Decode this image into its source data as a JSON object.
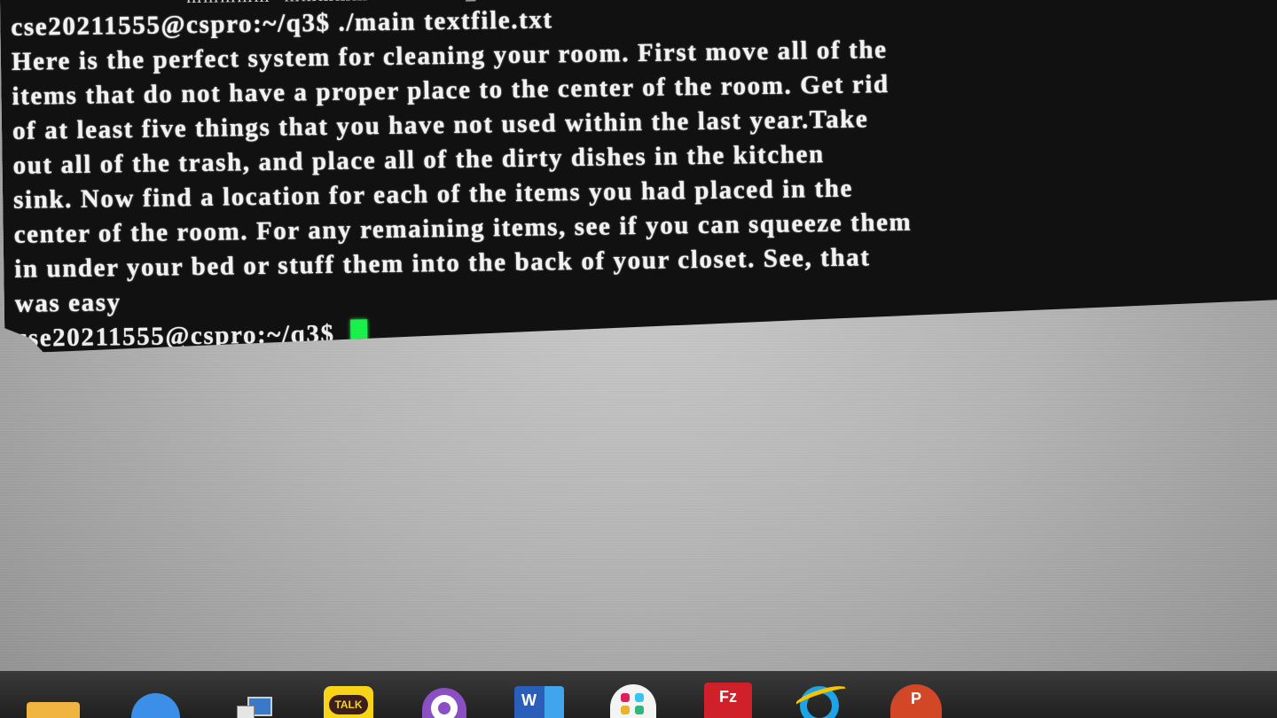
{
  "terminal": {
    "top_fragment": "mmmmm  mmmmm            m_m  m",
    "lines": [
      "cse20211555@cspro:~/q3$ ./main textfile.txt",
      "Here is the perfect system for cleaning your room. First move all of the",
      "items that do not have a proper place to the center of the room. Get rid",
      "of at least five things that you have not used within the last year.Take",
      "out all of the trash, and place all of the dirty dishes in the kitchen",
      "sink. Now find a location for each of the items you had placed in the",
      "center of the room. For any remaining items, see if you can squeeze them",
      "in under your bed or stuff them into the back of your closet. See, that",
      "was easy"
    ],
    "prompt": "cse20211555@cspro:~/q3$",
    "cursor_color": "#19f04a",
    "background_color": "#111111",
    "text_color": "#f2f2f2"
  },
  "taskbar": {
    "items": [
      {
        "name": "file-explorer-icon",
        "label": ""
      },
      {
        "name": "zoom-icon",
        "label": ""
      },
      {
        "name": "network-icon",
        "label": ""
      },
      {
        "name": "kakaotalk-icon",
        "label": "TALK"
      },
      {
        "name": "github-desktop-icon",
        "label": ""
      },
      {
        "name": "word-icon",
        "label": "W"
      },
      {
        "name": "slack-icon",
        "label": ""
      },
      {
        "name": "filezilla-icon",
        "label": "Fz"
      },
      {
        "name": "internet-explorer-icon",
        "label": ""
      },
      {
        "name": "powerpoint-icon",
        "label": "P"
      }
    ]
  }
}
